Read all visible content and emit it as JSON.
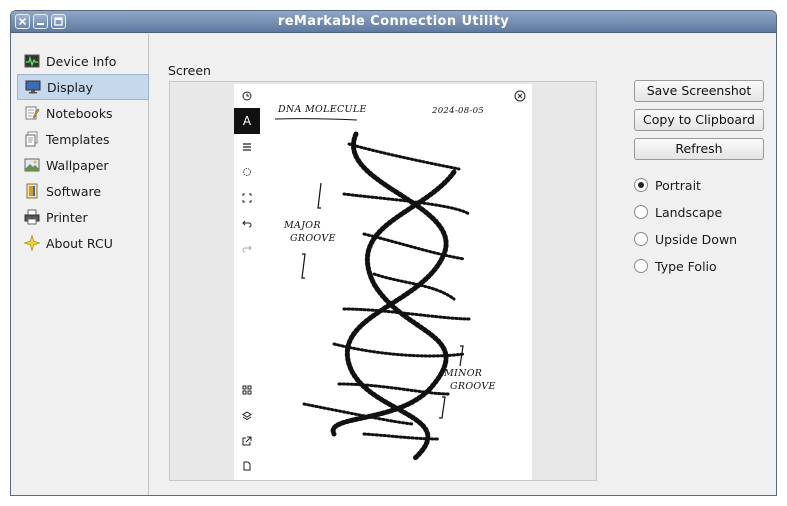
{
  "window": {
    "title": "reMarkable Connection Utility",
    "controls": [
      "close-icon",
      "minimize-icon",
      "maximize-icon"
    ]
  },
  "sidebar": {
    "items": [
      {
        "label": "Device Info",
        "icon": "device-info-icon",
        "active": false
      },
      {
        "label": "Display",
        "icon": "display-icon",
        "active": true
      },
      {
        "label": "Notebooks",
        "icon": "notebooks-icon",
        "active": false
      },
      {
        "label": "Templates",
        "icon": "templates-icon",
        "active": false
      },
      {
        "label": "Wallpaper",
        "icon": "wallpaper-icon",
        "active": false
      },
      {
        "label": "Software",
        "icon": "software-icon",
        "active": false
      },
      {
        "label": "Printer",
        "icon": "printer-icon",
        "active": false
      },
      {
        "label": "About RCU",
        "icon": "about-icon",
        "active": false
      }
    ]
  },
  "main": {
    "screen_label": "Screen",
    "screenshot": {
      "title": "DNA MOLECULE",
      "date": "2024-08-05",
      "annotations": [
        "MAJOR",
        "GROOVE",
        "MINOR",
        "GROOVE"
      ],
      "tools": [
        "clock-icon",
        "pen-icon",
        "menu-icon",
        "eraser-icon",
        "select-icon",
        "undo-icon",
        "redo-icon",
        "grid-icon",
        "layers-icon",
        "share-icon",
        "page-icon"
      ]
    },
    "buttons": {
      "save": "Save Screenshot",
      "copy": "Copy to Clipboard",
      "refresh": "Refresh"
    },
    "orientation": {
      "options": [
        "Portrait",
        "Landscape",
        "Upside Down",
        "Type Folio"
      ],
      "selected": "Portrait"
    }
  },
  "colors": {
    "titlebar": "#6f89ad",
    "selection": "#c6d8ec"
  }
}
